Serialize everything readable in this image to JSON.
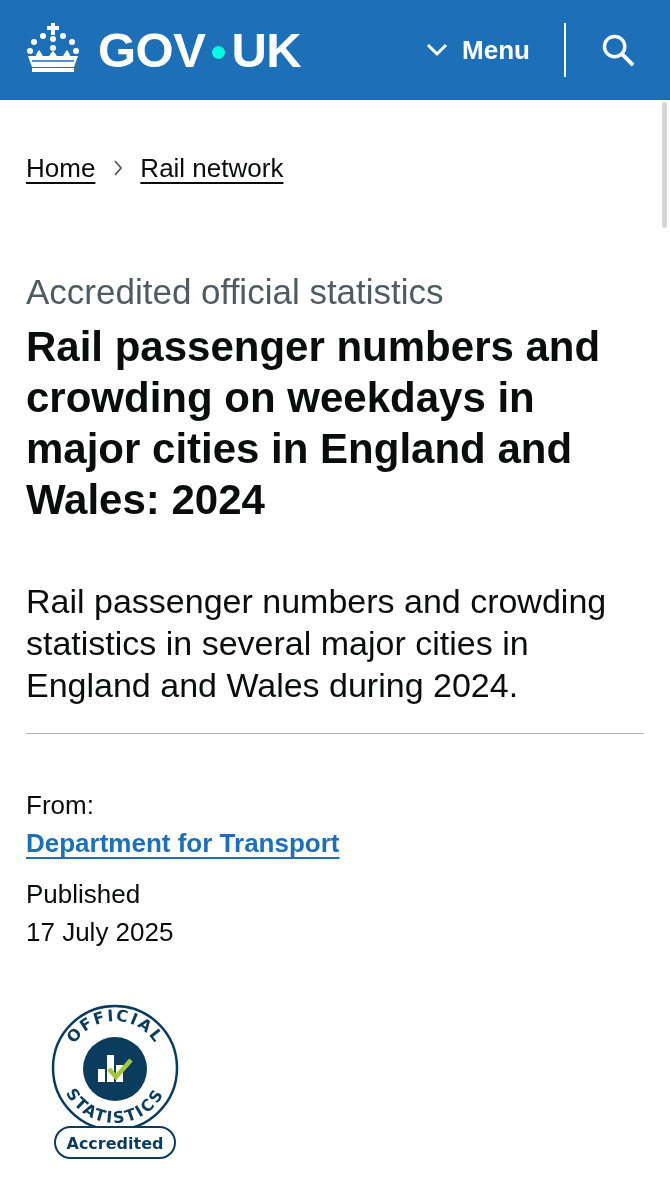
{
  "header": {
    "logo_words": [
      "GOV",
      "UK"
    ],
    "menu": {
      "label": "Menu",
      "expanded": false
    }
  },
  "breadcrumbs": [
    {
      "label": "Home"
    },
    {
      "label": "Rail network"
    }
  ],
  "caption": "Accredited official statistics",
  "title": "Rail passenger numbers and crowding on weekdays in major cities in England and Wales: 2024",
  "lead": "Rail passenger numbers and crowding statistics in several major cities in England and Wales during 2024.",
  "metadata": {
    "from_label": "From:",
    "organisations": [
      "Department for Transport"
    ],
    "published_label": "Published",
    "published_date": "17 July 2025"
  },
  "badge": {
    "top_text": "OFFICIAL",
    "bottom_text": "STATISTICS",
    "label": "Accredited"
  }
}
